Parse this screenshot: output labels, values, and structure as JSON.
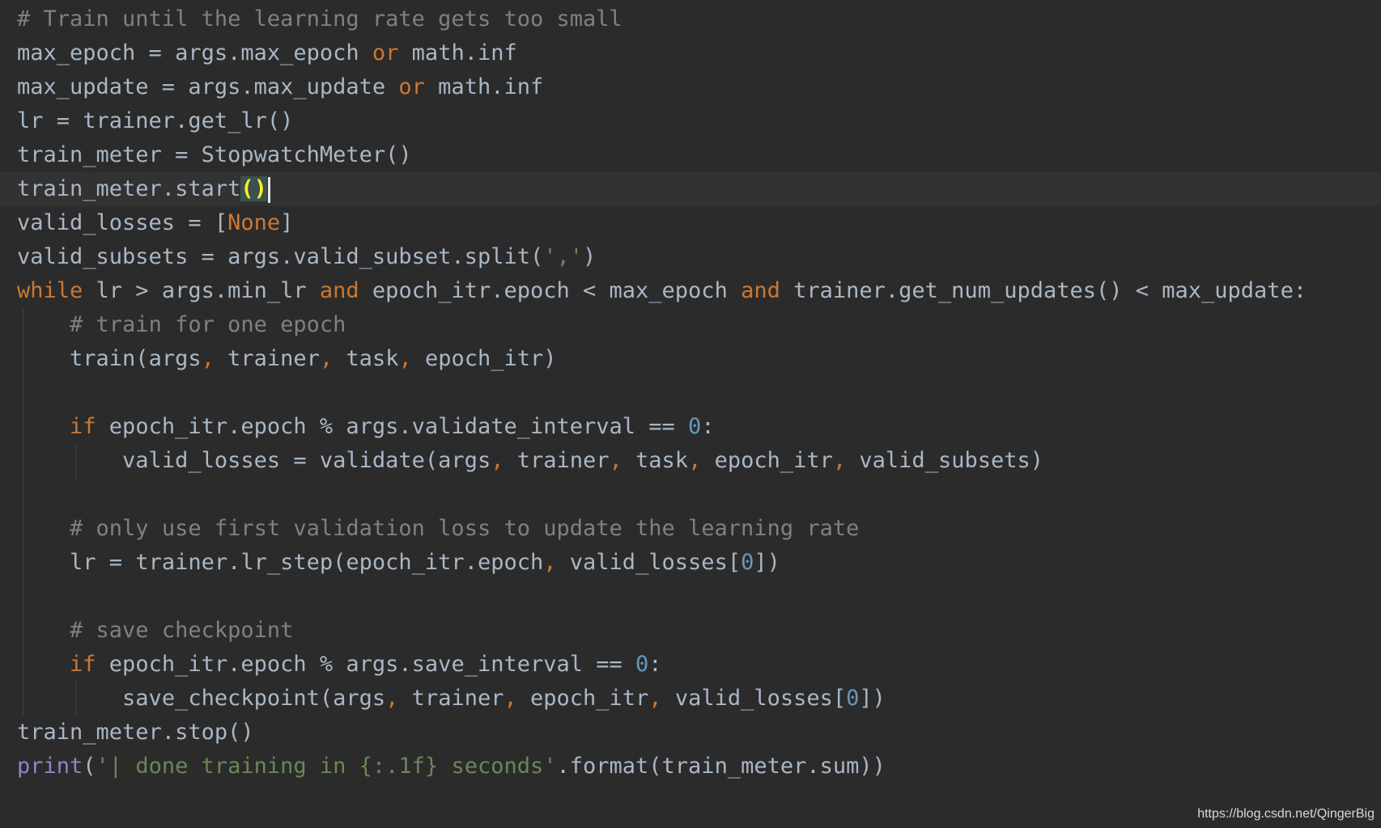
{
  "editor": {
    "lines": [
      {
        "indent": 0,
        "tokens": [
          {
            "t": "# Train until the learning rate gets too small",
            "c": "comment"
          }
        ]
      },
      {
        "indent": 0,
        "tokens": [
          {
            "t": "max_epoch = args.max_epoch ",
            "c": "plain"
          },
          {
            "t": "or",
            "c": "kw"
          },
          {
            "t": " math.inf",
            "c": "plain"
          }
        ]
      },
      {
        "indent": 0,
        "tokens": [
          {
            "t": "max_update = args.max_update ",
            "c": "plain"
          },
          {
            "t": "or",
            "c": "kw"
          },
          {
            "t": " math.inf",
            "c": "plain"
          }
        ]
      },
      {
        "indent": 0,
        "tokens": [
          {
            "t": "lr = trainer.get_lr()",
            "c": "plain"
          }
        ]
      },
      {
        "indent": 0,
        "tokens": [
          {
            "t": "train_meter = StopwatchMeter()",
            "c": "plain"
          }
        ]
      },
      {
        "indent": 0,
        "current": true,
        "tokens": [
          {
            "t": "train_meter.start",
            "c": "plain"
          },
          {
            "t": "()",
            "c": "match"
          }
        ]
      },
      {
        "indent": 0,
        "tokens": [
          {
            "t": "valid_losses = [",
            "c": "plain"
          },
          {
            "t": "None",
            "c": "kw"
          },
          {
            "t": "]",
            "c": "plain"
          }
        ]
      },
      {
        "indent": 0,
        "tokens": [
          {
            "t": "valid_subsets = args.valid_subset.split(",
            "c": "plain"
          },
          {
            "t": "','",
            "c": "str"
          },
          {
            "t": ")",
            "c": "plain"
          }
        ]
      },
      {
        "indent": 0,
        "tokens": [
          {
            "t": "while",
            "c": "kw"
          },
          {
            "t": " lr > args.min_lr ",
            "c": "plain"
          },
          {
            "t": "and",
            "c": "kw"
          },
          {
            "t": " epoch_itr.epoch < max_epoch ",
            "c": "plain"
          },
          {
            "t": "and",
            "c": "kw"
          },
          {
            "t": " trainer.get_num_updates() < max_update:",
            "c": "plain"
          }
        ]
      },
      {
        "indent": 1,
        "tokens": [
          {
            "t": "# train for one epoch",
            "c": "comment"
          }
        ]
      },
      {
        "indent": 1,
        "tokens": [
          {
            "t": "train(args",
            "c": "plain"
          },
          {
            "t": ",",
            "c": "punct"
          },
          {
            "t": " trainer",
            "c": "plain"
          },
          {
            "t": ",",
            "c": "punct"
          },
          {
            "t": " task",
            "c": "plain"
          },
          {
            "t": ",",
            "c": "punct"
          },
          {
            "t": " epoch_itr)",
            "c": "plain"
          }
        ]
      },
      {
        "indent": 1,
        "tokens": []
      },
      {
        "indent": 1,
        "tokens": [
          {
            "t": "if",
            "c": "kw"
          },
          {
            "t": " epoch_itr.epoch % args.validate_interval == ",
            "c": "plain"
          },
          {
            "t": "0",
            "c": "num"
          },
          {
            "t": ":",
            "c": "plain"
          }
        ]
      },
      {
        "indent": 2,
        "tokens": [
          {
            "t": "valid_losses = validate(args",
            "c": "plain"
          },
          {
            "t": ",",
            "c": "punct"
          },
          {
            "t": " trainer",
            "c": "plain"
          },
          {
            "t": ",",
            "c": "punct"
          },
          {
            "t": " task",
            "c": "plain"
          },
          {
            "t": ",",
            "c": "punct"
          },
          {
            "t": " epoch_itr",
            "c": "plain"
          },
          {
            "t": ",",
            "c": "punct"
          },
          {
            "t": " valid_subsets)",
            "c": "plain"
          }
        ]
      },
      {
        "indent": 1,
        "tokens": []
      },
      {
        "indent": 1,
        "tokens": [
          {
            "t": "# only use first validation loss to update the learning rate",
            "c": "comment"
          }
        ]
      },
      {
        "indent": 1,
        "tokens": [
          {
            "t": "lr = trainer.lr_step(epoch_itr.epoch",
            "c": "plain"
          },
          {
            "t": ",",
            "c": "punct"
          },
          {
            "t": " valid_losses[",
            "c": "plain"
          },
          {
            "t": "0",
            "c": "num"
          },
          {
            "t": "])",
            "c": "plain"
          }
        ]
      },
      {
        "indent": 1,
        "tokens": []
      },
      {
        "indent": 1,
        "tokens": [
          {
            "t": "# save checkpoint",
            "c": "comment"
          }
        ]
      },
      {
        "indent": 1,
        "tokens": [
          {
            "t": "if",
            "c": "kw"
          },
          {
            "t": " epoch_itr.epoch % args.save_interval == ",
            "c": "plain"
          },
          {
            "t": "0",
            "c": "num"
          },
          {
            "t": ":",
            "c": "plain"
          }
        ]
      },
      {
        "indent": 2,
        "tokens": [
          {
            "t": "save_checkpoint(args",
            "c": "plain"
          },
          {
            "t": ",",
            "c": "punct"
          },
          {
            "t": " trainer",
            "c": "plain"
          },
          {
            "t": ",",
            "c": "punct"
          },
          {
            "t": " epoch_itr",
            "c": "plain"
          },
          {
            "t": ",",
            "c": "punct"
          },
          {
            "t": " valid_losses[",
            "c": "plain"
          },
          {
            "t": "0",
            "c": "num"
          },
          {
            "t": "])",
            "c": "plain"
          }
        ]
      },
      {
        "indent": 0,
        "tokens": [
          {
            "t": "train_meter.stop()",
            "c": "plain"
          }
        ]
      },
      {
        "indent": 0,
        "tokens": [
          {
            "t": "print",
            "c": "builtin"
          },
          {
            "t": "(",
            "c": "plain"
          },
          {
            "t": "'| done training in {:.1f} seconds'",
            "c": "str"
          },
          {
            "t": ".format(train_meter.sum))",
            "c": "plain"
          }
        ]
      }
    ]
  },
  "colors": {
    "background": "#2b2b2b",
    "current_line": "#323232",
    "plain": "#a9b7c6",
    "keyword": "#cc7832",
    "comment": "#808080",
    "number": "#6897bb",
    "string": "#6a8759",
    "builtin": "#8888c6",
    "bracket_match": "#ffef28"
  },
  "watermark": {
    "text": "https://blog.csdn.net/QingerBig"
  }
}
